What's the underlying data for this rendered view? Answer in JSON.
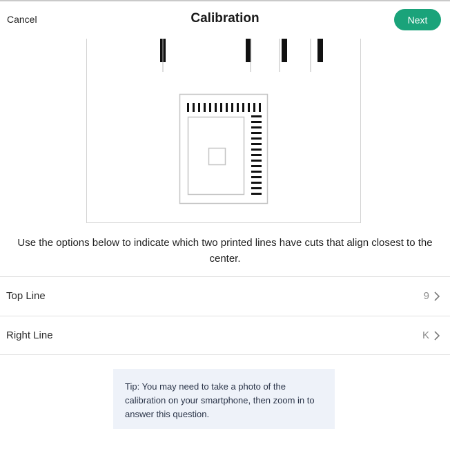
{
  "header": {
    "cancel_label": "Cancel",
    "title": "Calibration",
    "next_label": "Next"
  },
  "colors": {
    "accent": "#1aa37a",
    "tip_background": "#eef2f9"
  },
  "instructions": "Use the options below to indicate which two printed lines have cuts that align closest to the center.",
  "options": [
    {
      "label": "Top Line",
      "value": "9",
      "icon": "chevron-right-icon"
    },
    {
      "label": "Right Line",
      "value": "K",
      "icon": "chevron-right-icon"
    }
  ],
  "tip": "Tip: You may need to take a photo of the calibration on your smartphone, then zoom in to answer this question."
}
